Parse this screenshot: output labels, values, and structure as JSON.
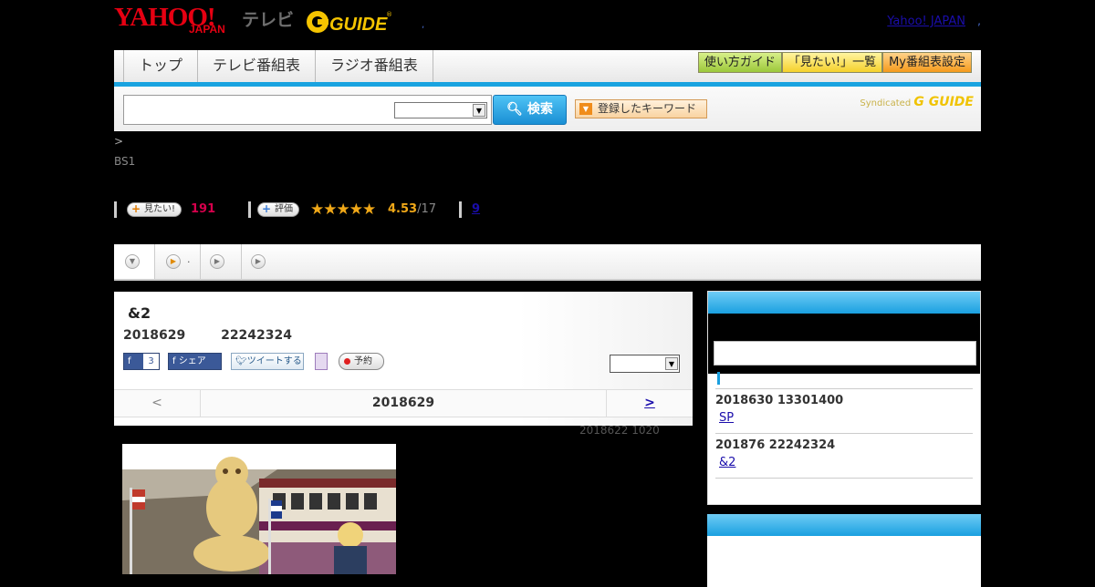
{
  "header": {
    "logo_yahoo": "YAHOO!",
    "logo_japan": "JAPAN",
    "logo_tv": "テレビ",
    "logo_gguide": "G GUIDE",
    "yahoo_japan_link": "Yahoo! JAPAN",
    "sep1": ",",
    "sep2": ","
  },
  "nav": {
    "tabs": [
      "トップ",
      "テレビ番組表",
      "ラジオ番組表"
    ],
    "right_buttons": [
      "使い方ガイド",
      "「見たい!」一覧",
      "My番組表設定"
    ]
  },
  "search": {
    "input_value": "",
    "select_value": "",
    "button_label": "検索",
    "keyword_button": "登録したキーワード",
    "syndicated": "Syndicated",
    "syndicated_logo": "G GUIDE"
  },
  "breadcrumb": ">",
  "channel": "BS1",
  "stats": {
    "mitai_label": "見たい!",
    "mitai_count": "191",
    "hyoka_label": "評価",
    "stars": "★★★★★",
    "rating": "4.53",
    "rating_count": "/17",
    "review_count": "9"
  },
  "tabs": {
    "tab2_text": "."
  },
  "program": {
    "title": "&2",
    "date": "2018629",
    "time": "22242324",
    "fb_count": "3",
    "fb_share": "シェア",
    "tweet": "ツイートする",
    "reserve": "予約",
    "select_value": "",
    "pager_prev": "<",
    "pager_current": "2018629",
    "pager_next": ">",
    "updated": "2018622  1020"
  },
  "sidebar": {
    "items": [
      {
        "date": "2018630  13301400",
        "link": "SP"
      },
      {
        "date": "201876  22242324",
        "link": "&2"
      }
    ]
  }
}
